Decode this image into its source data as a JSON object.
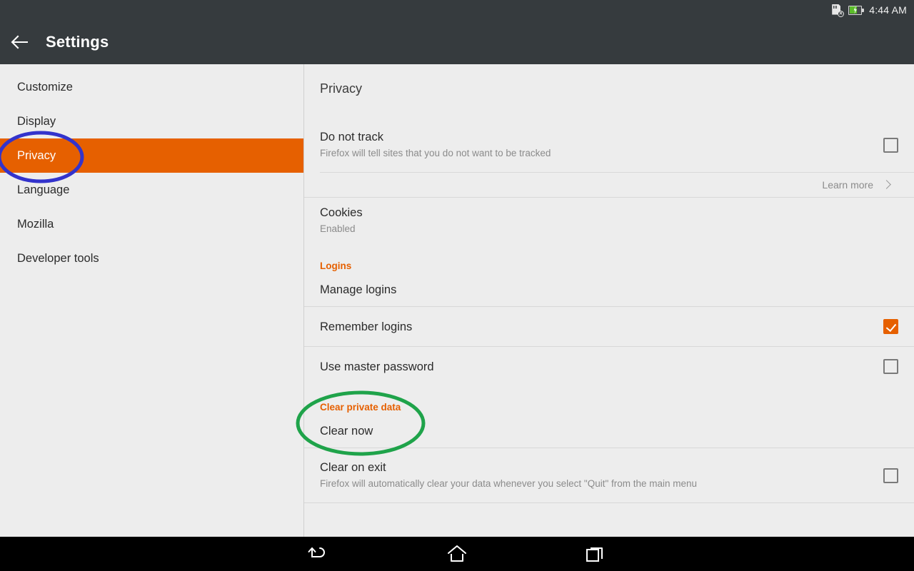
{
  "statusbar": {
    "time": "4:44 AM",
    "icons": [
      "sdcard-removed-icon",
      "battery-charging-icon"
    ]
  },
  "actionbar": {
    "back_label": "back-arrow",
    "title": "Settings"
  },
  "sidebar": {
    "items": [
      {
        "label": "Customize",
        "selected": false
      },
      {
        "label": "Display",
        "selected": false
      },
      {
        "label": "Privacy",
        "selected": true
      },
      {
        "label": "Language",
        "selected": false
      },
      {
        "label": "Mozilla",
        "selected": false
      },
      {
        "label": "Developer tools",
        "selected": false
      }
    ]
  },
  "panel": {
    "title": "Privacy",
    "do_not_track": {
      "title": "Do not track",
      "subtitle": "Firefox will tell sites that you do not want to be tracked",
      "checked": false
    },
    "learn_more": {
      "label": "Learn more",
      "chevron": "chevron-right-icon"
    },
    "cookies": {
      "title": "Cookies",
      "subtitle": "Enabled"
    },
    "logins_section": "Logins",
    "manage_logins": {
      "title": "Manage logins"
    },
    "remember_logins": {
      "title": "Remember logins",
      "checked": true
    },
    "use_master_password": {
      "title": "Use master password",
      "checked": false
    },
    "clear_private_data_section": "Clear private data",
    "clear_now": {
      "title": "Clear now"
    },
    "clear_on_exit": {
      "title": "Clear on exit",
      "subtitle": "Firefox will automatically clear your data whenever you select \"Quit\" from the main menu",
      "checked": false
    }
  },
  "navbar": {
    "buttons": [
      {
        "name": "back-icon"
      },
      {
        "name": "home-icon"
      },
      {
        "name": "recents-icon"
      }
    ]
  },
  "annotations": [
    {
      "name": "privacy-highlight-ellipse",
      "color": "#3333cc"
    },
    {
      "name": "clear-private-data-highlight-ellipse",
      "color": "#1fa34a"
    }
  ],
  "colors": {
    "accent_orange": "#e66000",
    "header_dark": "#363b3e",
    "page_background": "#ededed",
    "annotation_blue": "#3333cc",
    "annotation_green": "#1fa34a"
  }
}
